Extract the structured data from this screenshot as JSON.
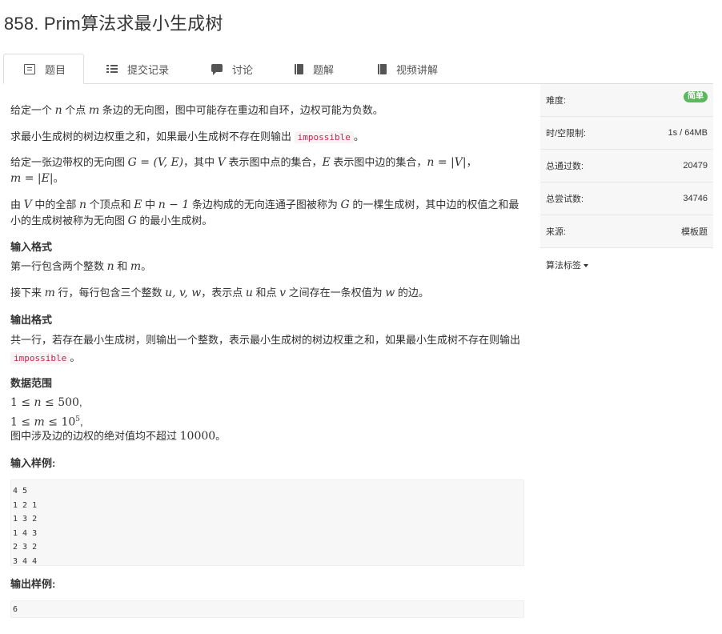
{
  "page_title": "858. Prim算法求最小生成树",
  "tabs": [
    {
      "label": "题目",
      "icon": "document-icon",
      "active": true
    },
    {
      "label": "提交记录",
      "icon": "list-icon",
      "active": false
    },
    {
      "label": "讨论",
      "icon": "chat-icon",
      "active": false
    },
    {
      "label": "题解",
      "icon": "book-icon",
      "active": false
    },
    {
      "label": "视频讲解",
      "icon": "book-icon",
      "active": false
    }
  ],
  "problem": {
    "p1": {
      "t1": "给定一个 ",
      "v1": "n",
      "t2": " 个点 ",
      "v2": "m",
      "t3": " 条边的无向图，图中可能存在重边和自环，边权可能为负数。"
    },
    "p2": {
      "t1": "求最小生成树的树边权重之和，如果最小生成树不存在则输出 ",
      "code": "impossible",
      "t2": "。"
    },
    "p3": {
      "t1": "给定一张边带权的无向图 ",
      "v1": "G = (V, E)",
      "t2": "，其中 ",
      "v2": "V",
      "t3": " 表示图中点的集合，",
      "v3": "E",
      "t4": " 表示图中边的集合，",
      "v4": "n = |V|",
      "t5": "，",
      "v5": "m = |E|",
      "t6": "。"
    },
    "p4": {
      "t1": "由 ",
      "v1": "V",
      "t2": " 中的全部 ",
      "v2": "n",
      "t3": " 个顶点和 ",
      "v3": "E",
      "t4": " 中 ",
      "v4": "n − 1",
      "t5": " 条边构成的无向连通子图被称为 ",
      "v5": "G",
      "t6": " 的一棵生成树，其中边的权值之和最小的生成树被称为无向图 ",
      "v6": "G",
      "t7": " 的最小生成树。"
    },
    "input_format_heading": "输入格式",
    "if1": {
      "t1": "第一行包含两个整数 ",
      "v1": "n",
      "t2": " 和 ",
      "v2": "m",
      "t3": "。"
    },
    "if2": {
      "t1": "接下来 ",
      "v1": "m",
      "t2": " 行，每行包含三个整数 ",
      "v2": "u, v, w",
      "t3": "，表示点 ",
      "v3": "u",
      "t4": " 和点 ",
      "v4": "v",
      "t5": " 之间存在一条权值为 ",
      "v5": "w",
      "t6": " 的边。"
    },
    "output_format_heading": "输出格式",
    "of1": {
      "t1": "共一行，若存在最小生成树，则输出一个整数，表示最小生成树的树边权重之和，如果最小生成树不存在则输出 ",
      "code": "impossible",
      "t2": "。"
    },
    "range_heading": "数据范围",
    "r1": {
      "a": "1 ≤ ",
      "b": "n",
      "c": " ≤ 500",
      "d": ","
    },
    "r2": {
      "a": "1 ≤ ",
      "b": "m",
      "c": " ≤ 10",
      "sup": "5",
      "d": ","
    },
    "r3": {
      "t1": "图中涉及边的边权的绝对值均不超过 ",
      "v1": "10000",
      "t2": "。"
    },
    "sample_input_heading": "输入样例:",
    "sample_input": "4 5\n1 2 1\n1 3 2\n1 4 3\n2 3 2\n3 4 4",
    "sample_output_heading": "输出样例:",
    "sample_output": "6"
  },
  "sidebar": {
    "rows": [
      {
        "label": "难度:",
        "value": "简单"
      },
      {
        "label": "时/空限制:",
        "value": "1s / 64MB"
      },
      {
        "label": "总通过数:",
        "value": "20479"
      },
      {
        "label": "总尝试数:",
        "value": "34746"
      },
      {
        "label": "来源:",
        "value": "模板题"
      }
    ],
    "tags_label": "算法标签",
    "badge_color": "#5cb85c"
  }
}
